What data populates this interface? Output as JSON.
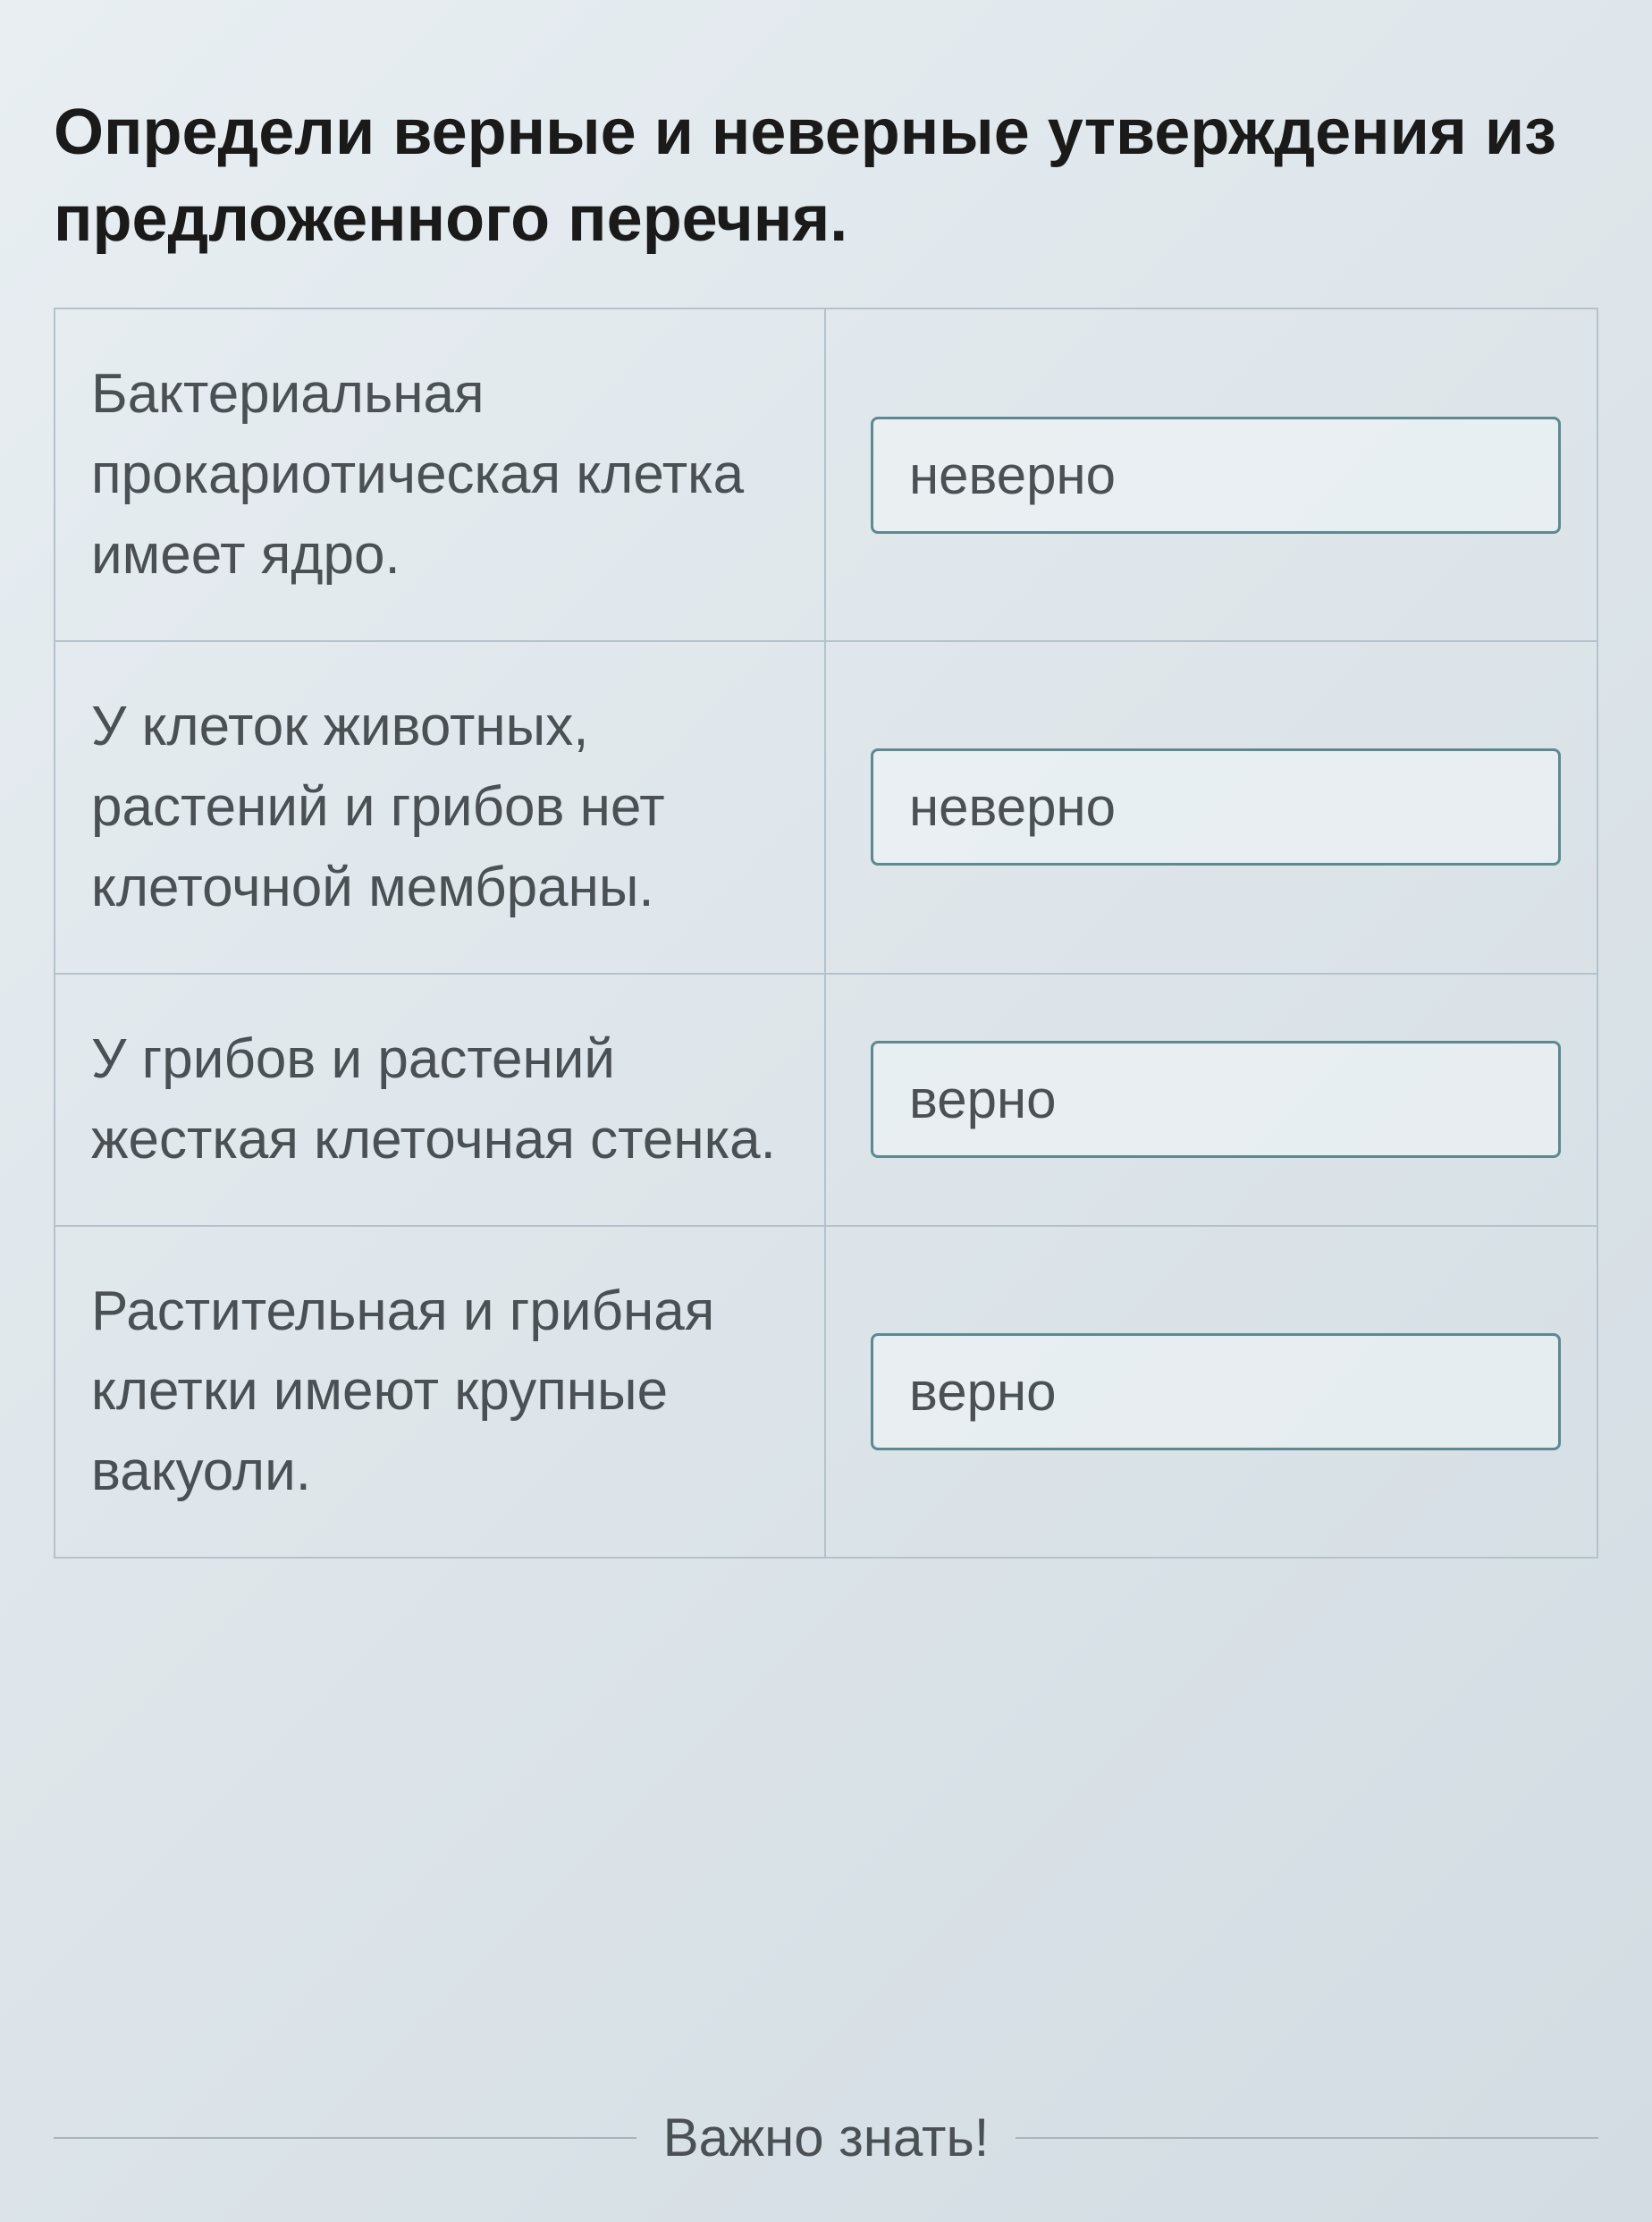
{
  "question": {
    "title": "Определи верные и неверные утверждения из предложенного перечня."
  },
  "rows": [
    {
      "statement": "Бактериальная прокариотическая клетка имеет ядро.",
      "answer": "неверно"
    },
    {
      "statement": "У клеток животных, растений и грибов нет клеточной мембраны.",
      "answer": "неверно"
    },
    {
      "statement": "У грибов и растений жесткая клеточная стенка.",
      "answer": "верно"
    },
    {
      "statement": "Растительная и грибная клетки имеют крупные вакуоли.",
      "answer": "верно"
    }
  ],
  "footer": {
    "label": "Важно знать!"
  }
}
